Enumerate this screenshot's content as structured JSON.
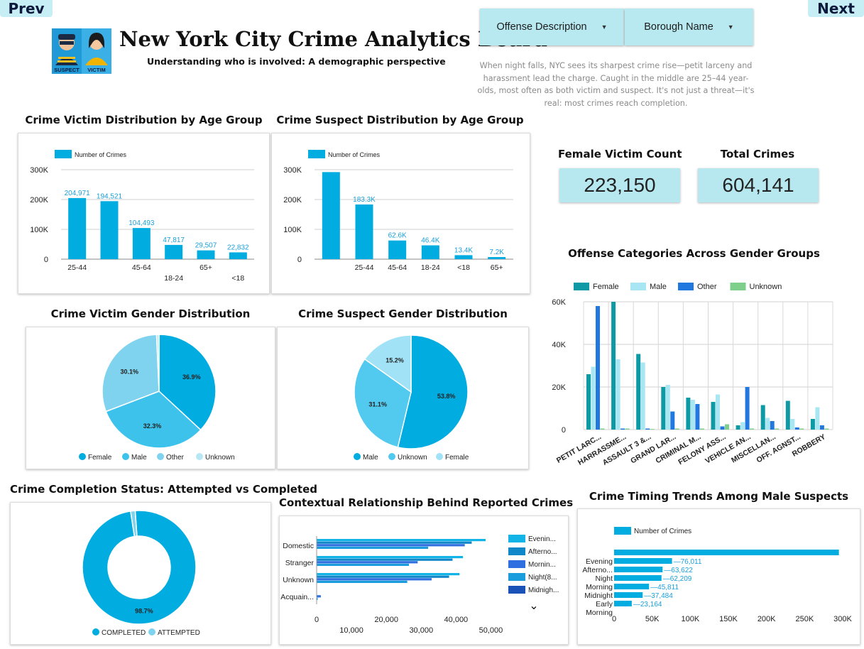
{
  "nav": {
    "prev_label": "Prev",
    "next_label": "Next"
  },
  "header": {
    "title": "New York City Crime Analytics Board",
    "subtitle": "Understanding who is involved: A demographic perspective",
    "logo_labels": {
      "suspect": "SUSPECT",
      "victim": "VICTIM"
    }
  },
  "filters": {
    "offense": {
      "label": "Offense Description",
      "icon": "chevron-down-icon"
    },
    "borough": {
      "label": "Borough Name",
      "icon": "chevron-down-icon"
    }
  },
  "description": "When night falls, NYC sees its sharpest crime rise—petit larceny and harassment lead the charge. Caught in the middle are 25–44 year-olds, most often as both victim and suspect. It's not just a threat—it's real: most crimes reach completion.",
  "kpis": {
    "female_victims": {
      "label": "Female Victim Count",
      "value": "223,150"
    },
    "total_crimes": {
      "label": "Total Crimes",
      "value": "604,141"
    }
  },
  "colors": {
    "primary": "#00ace0",
    "female": "#0d9aa5",
    "male": "#a8e6f3",
    "other": "#2178de",
    "unknown": "#7fcf8c"
  },
  "chart_data": [
    {
      "id": "victim_age",
      "type": "bar",
      "title": "Crime Victim Distribution by Age Group",
      "legend": "Number of Crimes",
      "categories": [
        "25-44",
        "45-64",
        "18-24",
        "65+",
        "<18"
      ],
      "values": [
        204971,
        194521,
        104493,
        47817,
        29507,
        22832
      ],
      "value_labels": [
        "204,971",
        "194,521",
        "104,493",
        "47,817",
        "29,507",
        "22,832"
      ],
      "x_tick_labels": [
        "25-44",
        "",
        "45-64",
        "18-24",
        "65+",
        "<18"
      ],
      "y_ticks": [
        "0",
        "100K",
        "200K",
        "300K"
      ],
      "ylim": [
        0,
        300000
      ]
    },
    {
      "id": "suspect_age",
      "type": "bar",
      "title": "Crime Suspect Distribution by Age Group",
      "legend": "Number of Crimes",
      "categories": [
        "",
        "25-44",
        "45-64",
        "18-24",
        "<18",
        "65+"
      ],
      "values": [
        292000,
        183300,
        62600,
        46400,
        13400,
        7200
      ],
      "value_labels": [
        "",
        "183.3K",
        "62.6K",
        "46.4K",
        "13.4K",
        "7.2K"
      ],
      "y_ticks": [
        "0",
        "100K",
        "200K",
        "300K"
      ],
      "ylim": [
        0,
        300000
      ]
    },
    {
      "id": "victim_gender",
      "type": "pie",
      "title": "Crime Victim Gender Distribution",
      "labels": [
        "Female",
        "Male",
        "Other",
        "Unknown"
      ],
      "values": [
        36.9,
        32.3,
        30.1,
        0.7
      ],
      "value_labels": [
        "36.9%",
        "32.3%",
        "30.1%",
        ""
      ],
      "colors": [
        "#00ace0",
        "#3dc3eb",
        "#7fd3ee",
        "#b7e7f5"
      ]
    },
    {
      "id": "suspect_gender",
      "type": "pie",
      "title": "Crime Suspect Gender Distribution",
      "labels": [
        "Male",
        "Unknown",
        "Female"
      ],
      "values": [
        53.8,
        31.1,
        15.2
      ],
      "value_labels": [
        "53.8%",
        "31.1%",
        "15.2%"
      ],
      "colors": [
        "#00ace0",
        "#52c9ee",
        "#a2e2f6"
      ]
    },
    {
      "id": "offense_gender",
      "type": "bar",
      "title": "Offense Categories Across Gender Groups",
      "categories": [
        "PETIT LARC...",
        "HARRASSME...",
        "ASSAULT 3 &...",
        "GRAND LAR...",
        "CRIMINAL M...",
        "FELONY ASS...",
        "VEHICLE AN...",
        "MISCELLAN...",
        "OFF. AGNST...",
        "ROBBERY"
      ],
      "series": [
        {
          "name": "Female",
          "values": [
            26000,
            61000,
            35500,
            20000,
            15000,
            13000,
            2000,
            11500,
            13500,
            5000
          ]
        },
        {
          "name": "Male",
          "values": [
            29500,
            33000,
            31500,
            21000,
            14000,
            16500,
            3500,
            5500,
            5000,
            10500
          ]
        },
        {
          "name": "Other",
          "values": [
            58000,
            500,
            500,
            8500,
            12000,
            1500,
            20000,
            4000,
            1000,
            2000
          ]
        },
        {
          "name": "Unknown",
          "values": [
            500,
            500,
            300,
            500,
            500,
            2500,
            500,
            500,
            500,
            500
          ]
        }
      ],
      "y_ticks": [
        "0",
        "20K",
        "40K",
        "60K"
      ],
      "ylim": [
        0,
        60000
      ]
    },
    {
      "id": "completion",
      "type": "pie",
      "title": "Crime Completion Status: Attempted vs Completed",
      "labels": [
        "COMPLETED",
        "ATTEMPTED"
      ],
      "values": [
        98.7,
        1.3
      ],
      "value_labels": [
        "98.7%",
        ""
      ],
      "colors": [
        "#00ace0",
        "#7fd3ee"
      ]
    },
    {
      "id": "relationship",
      "type": "bar",
      "title": "Contextual Relationship Behind Reported Crimes",
      "categories": [
        "Domestic",
        "Stranger",
        "Unknown",
        "Acquain..."
      ],
      "series": [
        {
          "name": "Evenin...",
          "values": [
            48500,
            42000,
            41000,
            0
          ]
        },
        {
          "name": "Afterno...",
          "values": [
            44500,
            39000,
            38000,
            0
          ]
        },
        {
          "name": "Mornin...",
          "values": [
            42500,
            29000,
            33000,
            1200
          ]
        },
        {
          "name": "Night(8...",
          "values": [
            32000,
            26500,
            26000,
            300
          ]
        },
        {
          "name": "Midnigh...",
          "values": [
            22000,
            23000,
            14500,
            200
          ]
        },
        {
          "name": "",
          "values": [
            12000,
            9000,
            7500,
            0
          ]
        }
      ],
      "x_ticks_top": [
        "0",
        "20,000",
        "40,000"
      ],
      "x_ticks_bottom": [
        "10,000",
        "30,000",
        "50,000"
      ],
      "xlim": [
        0,
        55000
      ]
    },
    {
      "id": "male_timing",
      "type": "bar",
      "title": "Crime Timing Trends Among Male Suspects",
      "legend": "Number of Crimes",
      "categories": [
        "",
        "Evening",
        "Afterno...",
        "Night",
        "Morning",
        "Midnight",
        "Early",
        "Morning"
      ],
      "values": [
        295000,
        76011,
        63622,
        62209,
        45811,
        37484,
        23164,
        0
      ],
      "value_labels": [
        "",
        "76,011",
        "63,622",
        "62,209",
        "45,811",
        "37,484",
        "23,164",
        ""
      ],
      "x_ticks": [
        "0",
        "50K",
        "100K",
        "150K",
        "200K",
        "250K",
        "300K"
      ],
      "xlim": [
        0,
        300000
      ]
    }
  ]
}
